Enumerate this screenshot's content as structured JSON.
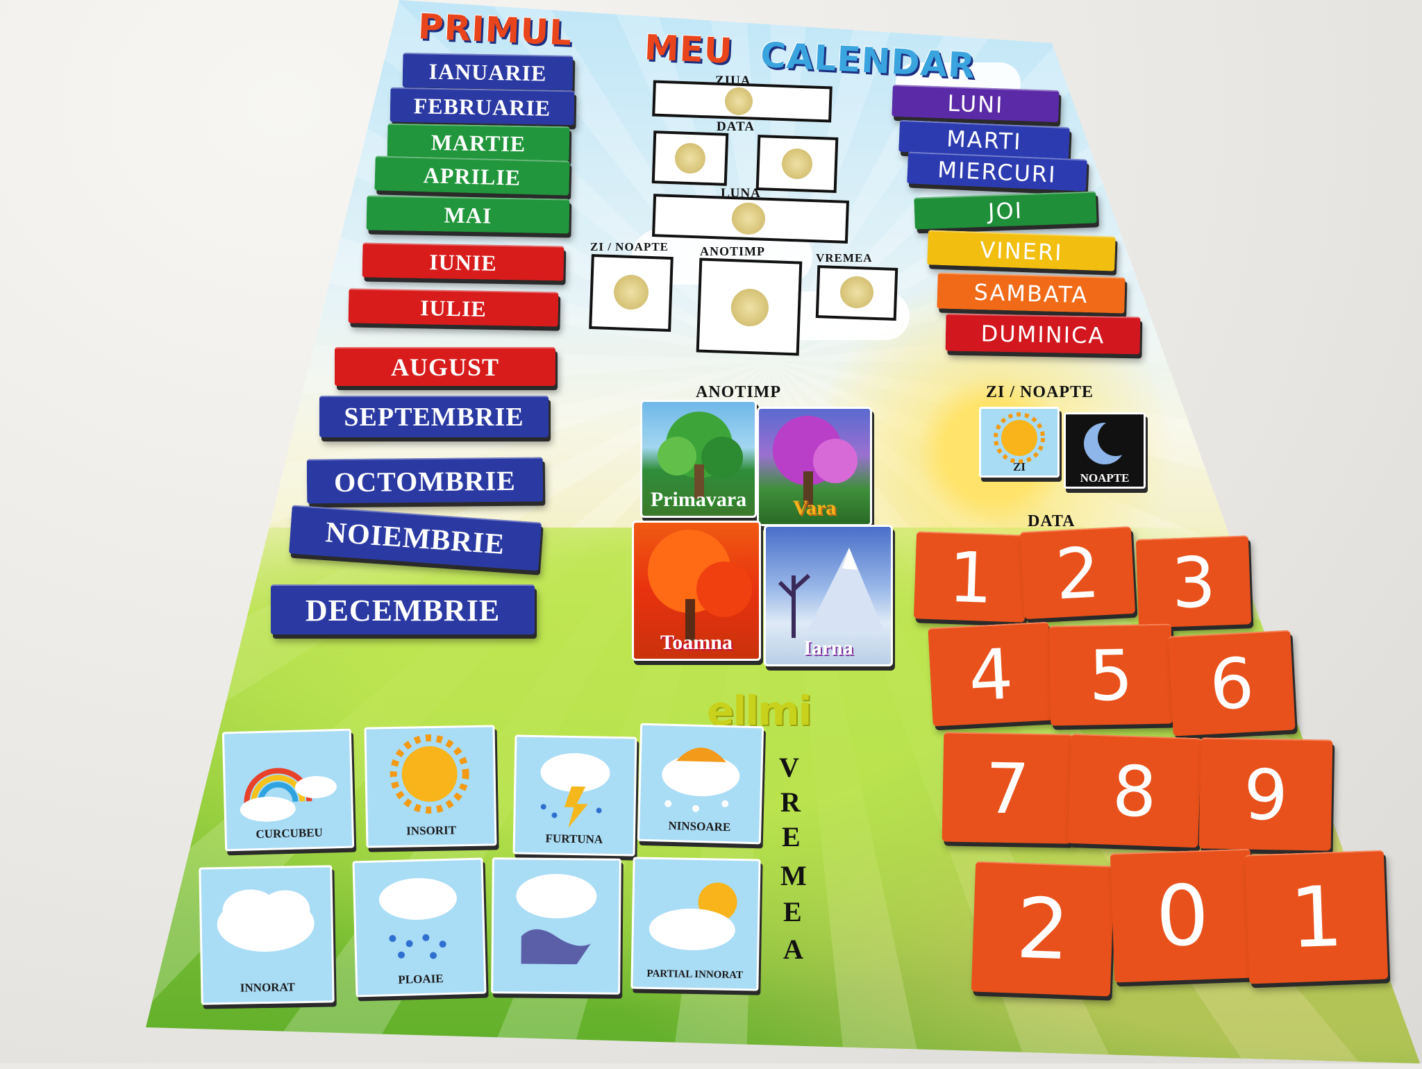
{
  "title": {
    "word1": "PRIMUL",
    "word2": "MEU",
    "word3": "CALENDAR"
  },
  "months": [
    "IANUARIE",
    "FEBRUARIE",
    "MARTIE",
    "APRILIE",
    "MAI",
    "IUNIE",
    "IULIE",
    "AUGUST",
    "SEPTEMBRIE",
    "OCTOMBRIE",
    "NOIEMBRIE",
    "DECEMBRIE"
  ],
  "days": [
    "LUNI",
    "MARTI",
    "MIERCURI",
    "JOI",
    "VINERI",
    "SAMBATA",
    "DUMINICA"
  ],
  "slots": {
    "ziua": "ZIUA",
    "data": "DATA",
    "luna": "LUNA",
    "zi_noapte": "ZI / NOAPTE",
    "anotimp": "ANOTIMP",
    "vremea": "VREMEA"
  },
  "sections": {
    "anotimp": "ANOTIMP",
    "zi_noapte": "ZI / NOAPTE",
    "data": "DATA",
    "vremea_letters": [
      "V",
      "R",
      "E",
      "M",
      "E",
      "A"
    ]
  },
  "seasons": [
    "Primavara",
    "Vara",
    "Toamna",
    "Iarna"
  ],
  "day_night": [
    "ZI",
    "NOAPTE"
  ],
  "numbers": [
    "1",
    "2",
    "3",
    "4",
    "5",
    "6",
    "7",
    "8",
    "9",
    "2",
    "0",
    "1"
  ],
  "weather": [
    "CURCUBEU",
    "INSORIT",
    "FURTUNA",
    "NINSOARE",
    "INNORAT",
    "PLOAIE",
    "",
    "PARTIAL INNORAT"
  ],
  "brand": "ellmi",
  "colors": {
    "months_blue": "#2b3aa3",
    "months_green": "#21963c",
    "months_red": "#d81c1c",
    "number_tile": "#e8511b"
  }
}
